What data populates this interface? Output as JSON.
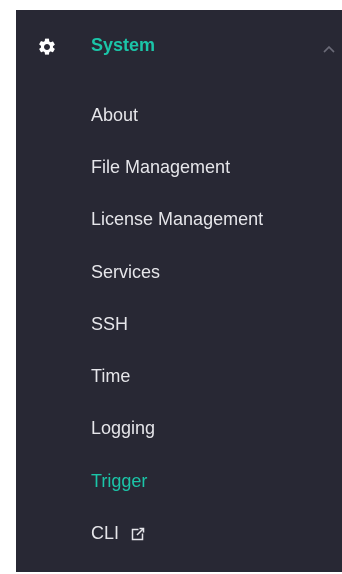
{
  "sidebar": {
    "section": {
      "title": "System",
      "icon": "gear-icon",
      "expanded": true,
      "toggle_icon": "chevron-up-icon"
    },
    "items": [
      {
        "label": "About",
        "active": false
      },
      {
        "label": "File Management",
        "active": false
      },
      {
        "label": "License Management",
        "active": false
      },
      {
        "label": "Services",
        "active": false
      },
      {
        "label": "SSH",
        "active": false
      },
      {
        "label": "Time",
        "active": false
      },
      {
        "label": "Logging",
        "active": false
      },
      {
        "label": "Trigger",
        "active": true
      },
      {
        "label": "CLI",
        "active": false,
        "icon": "external-link-icon"
      }
    ]
  },
  "colors": {
    "sidebar_bg": "#282834",
    "accent": "#1bc5a8",
    "text": "#e6e6ea",
    "chevron": "#6b6b78"
  }
}
